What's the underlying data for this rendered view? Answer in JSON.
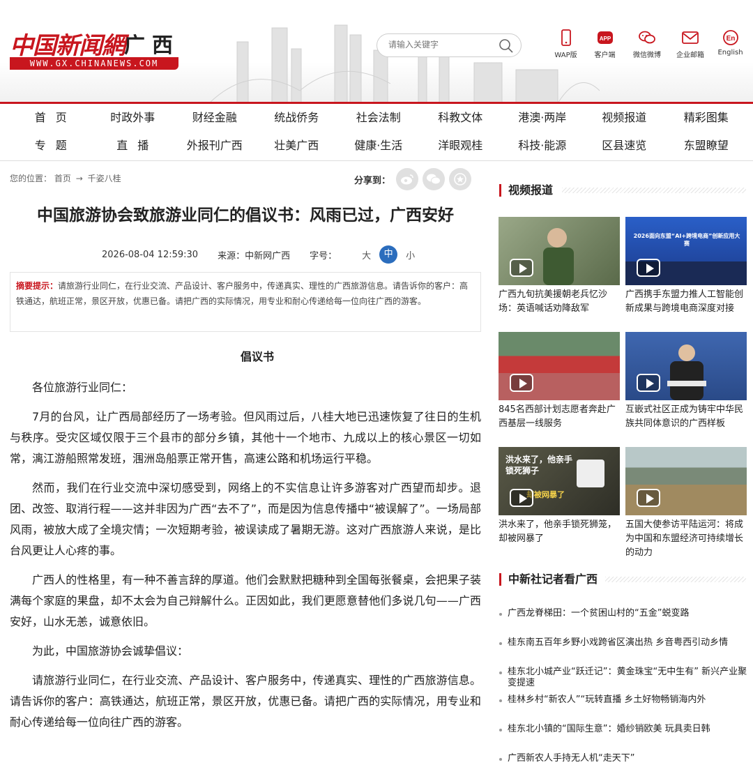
{
  "header": {
    "logo_cn": "中国新闻網",
    "logo_region": "广西",
    "logo_url": "WWW.GX.CHINANEWS.COM",
    "search_placeholder": "请输入关键字",
    "tools": [
      {
        "label": "WAP版",
        "icon": "phone-icon"
      },
      {
        "label": "客户端",
        "icon": "app-icon"
      },
      {
        "label": "微信微博",
        "icon": "wechat-icon"
      },
      {
        "label": "企业邮箱",
        "icon": "mail-icon"
      },
      {
        "label": "English",
        "icon": "english-icon",
        "badge": "En"
      }
    ],
    "app_badge": "APP"
  },
  "nav": {
    "row1": [
      "首页",
      "时政外事",
      "财经金融",
      "统战侨务",
      "社会法制",
      "科教文体",
      "港澳·两岸",
      "视频报道",
      "精彩图集"
    ],
    "row2": [
      "专题",
      "直播",
      "外报刊广西",
      "壮美广西",
      "健康·生活",
      "洋眼观桂",
      "科技·能源",
      "区县速览",
      "东盟瞭望"
    ]
  },
  "breadcrumb": {
    "label": "您的位置：",
    "home": "首页",
    "arrow": "→",
    "current": "千姿八桂"
  },
  "share": {
    "label": "分享到："
  },
  "article": {
    "title": "中国旅游协会致旅游业同仁的倡议书：风雨已过，广西安好",
    "datetime": "2026-08-04 12:59:30",
    "source": "来源：中新网广西",
    "fontsize_label": "字号：",
    "fontsizes": [
      "大",
      "中",
      "小"
    ],
    "summary_label": "摘要提示：",
    "summary": "请旅游行业同仁，在行业交流、产品设计、客户服务中，传递真实、理性的广西旅游信息。请告诉你的客户：高铁通达，航班正常，景区开放，优惠已备。请把广西的实际情况，用专业和耐心传递给每一位向往广西的游客。",
    "heading": "倡议书",
    "paragraphs": [
      "各位旅游行业同仁：",
      "7月的台风，让广西局部经历了一场考验。但风雨过后，八桂大地已迅速恢复了往日的生机与秩序。受灾区域仅限于三个县市的部分乡镇，其他十一个地市、九成以上的核心景区一切如常，漓江游船照常发班，涠洲岛船票正常开售，高速公路和机场运行平稳。",
      "然而，我们在行业交流中深切感受到，网络上的不实信息让许多游客对广西望而却步。退团、改签、取消行程——这并非因为广西“去不了”，而是因为信息传播中“被误解了”。一场局部风雨，被放大成了全境灾情；一次短期考验，被误读成了暑期无游。这对广西旅游人来说，是比台风更让人心疼的事。",
      "广西人的性格里，有一种不善言辞的厚道。他们会默默把糖种到全国每张餐桌，会把果子装满每个家庭的果盘，却不太会为自己辩解什么。正因如此，我们更愿意替他们多说几句——广西安好，山水无恙，诚意依旧。",
      "为此，中国旅游协会诚挚倡议：",
      "请旅游行业同仁，在行业交流、产品设计、客户服务中，传递真实、理性的广西旅游信息。请告诉你的客户：高铁通达，航班正常，景区开放，优惠已备。请把广西的实际情况，用专业和耐心传递给每一位向往广西的游客。"
    ]
  },
  "sidebar": {
    "video_title": "视频报道",
    "videos": [
      {
        "caption": "广西九旬抗美援朝老兵忆沙场：英语喊话劝降敌军",
        "thumb_color": "#7a8a6a"
      },
      {
        "caption": "广西携手东盟力推人工智能创新成果与跨境电商深度对接",
        "thumb_color": "#2a4fa8",
        "thumb_text": "2026面向东盟“AI+跨境电商”创新应用大赛"
      },
      {
        "caption": "845名西部计划志愿者奔赴广西基层一线服务",
        "thumb_color": "#b33a3a"
      },
      {
        "caption": "互嵌式社区正成为铸牢中华民族共同体意识的广西样板",
        "thumb_color": "#3f5f9a"
      },
      {
        "caption": "洪水来了，他亲手锁死狮笼，却被网暴了",
        "thumb_color": "#4a4a3a",
        "thumb_text": "洪水来了，他亲手锁死狮子",
        "thumb_text2": "却被网暴了"
      },
      {
        "caption": "五国大使参访平陆运河：将成为中国和东盟经济可持续增长的动力",
        "thumb_color": "#8a9a8a"
      }
    ],
    "reporter_title": "中新社记者看广西",
    "news": [
      "广西龙脊梯田：一个贫困山村的“五金”蜕变路",
      "桂东南五百年乡野小戏跨省区演出热 乡音粤西引动乡情",
      "桂东北小城产业“跃迁记”：黄金珠宝“无中生有” 新兴产业聚变提速",
      "桂林乡村“新农人”“玩转直播 乡土好物畅销海内外",
      "桂东北小镇的“国际生意”：婚纱销欧美 玩具卖日韩",
      "广西新农人手持无人机“走天下”"
    ]
  },
  "colors": {
    "brand_red": "#c8161e",
    "accent_blue": "#2b6dbd"
  }
}
